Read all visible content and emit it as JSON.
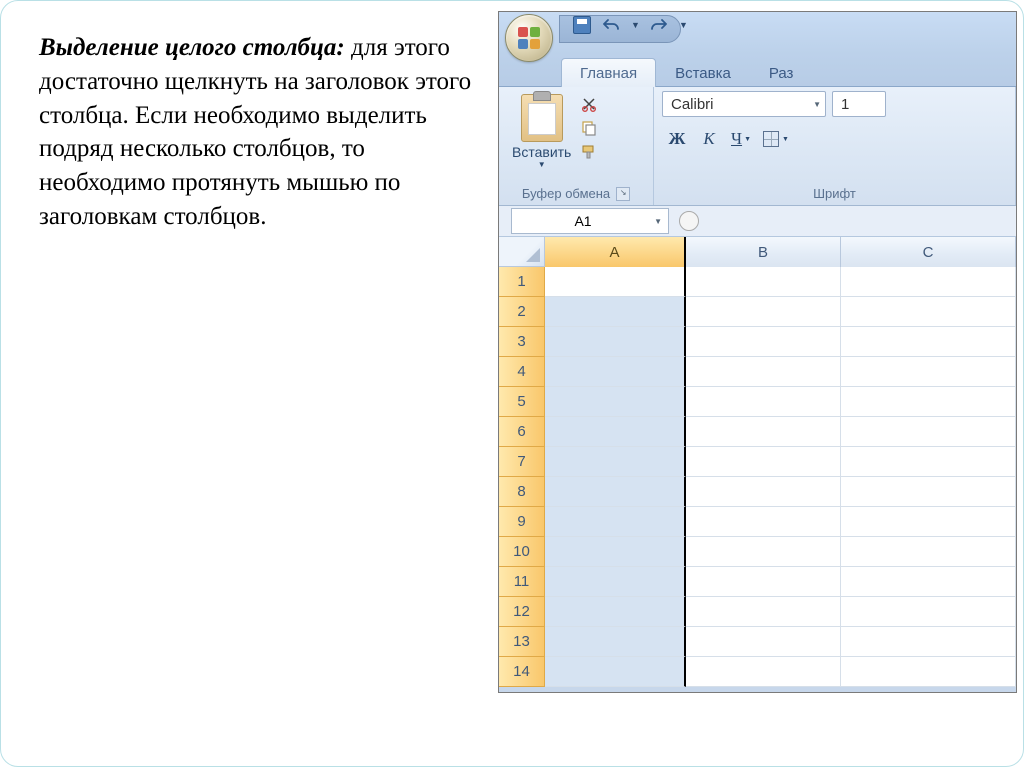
{
  "text": {
    "title": "Выделение целого столбца:",
    "body": " для этого достаточно щелкнуть на заголовок этого столбца. Если необходимо выделить  подряд несколько столбцов, то необходимо протянуть мышью по заголовкам столбцов."
  },
  "ribbon": {
    "tabs": {
      "home": "Главная",
      "insert": "Вставка",
      "layout": "Раз"
    },
    "clipboard": {
      "paste": "Вставить",
      "group": "Буфер обмена"
    },
    "font": {
      "name": "Calibri",
      "size": "1",
      "bold": "Ж",
      "italic": "К",
      "underline": "Ч",
      "group": "Шрифт"
    }
  },
  "namebox": "A1",
  "columns": [
    "A",
    "B",
    "C"
  ],
  "rows": [
    "1",
    "2",
    "3",
    "4",
    "5",
    "6",
    "7",
    "8",
    "9",
    "10",
    "11",
    "12",
    "13",
    "14"
  ]
}
